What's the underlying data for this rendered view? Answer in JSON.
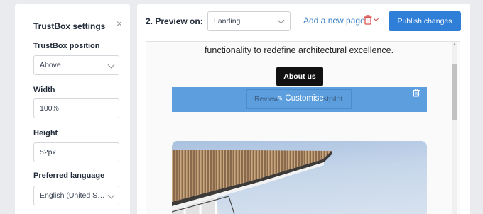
{
  "settings": {
    "title": "TrustBox settings",
    "close_icon": "close-icon",
    "fields": {
      "position": {
        "label": "TrustBox position",
        "value": "Above"
      },
      "width": {
        "label": "Width",
        "value": "100%"
      },
      "height": {
        "label": "Height",
        "value": "52px"
      },
      "language": {
        "label": "Preferred language",
        "value": "English (United States)"
      }
    }
  },
  "toolbar": {
    "preview_label": "2. Preview on:",
    "preview_page": "Landing",
    "add_page_label": "Add a new page",
    "delete_icon": "trash-icon",
    "publish_label": "Publish changes"
  },
  "preview": {
    "text": "functionality to redefine architectural excellence.",
    "about_button": "About us",
    "widget_text_left": "Review",
    "widget_text_right": "ustpilot",
    "customise_label": "Customise",
    "image": "building-photo"
  },
  "colors": {
    "accent": "#2f7ed8",
    "link": "#3b82c4",
    "widget": "#5d9fde",
    "danger": "#d9534f"
  }
}
